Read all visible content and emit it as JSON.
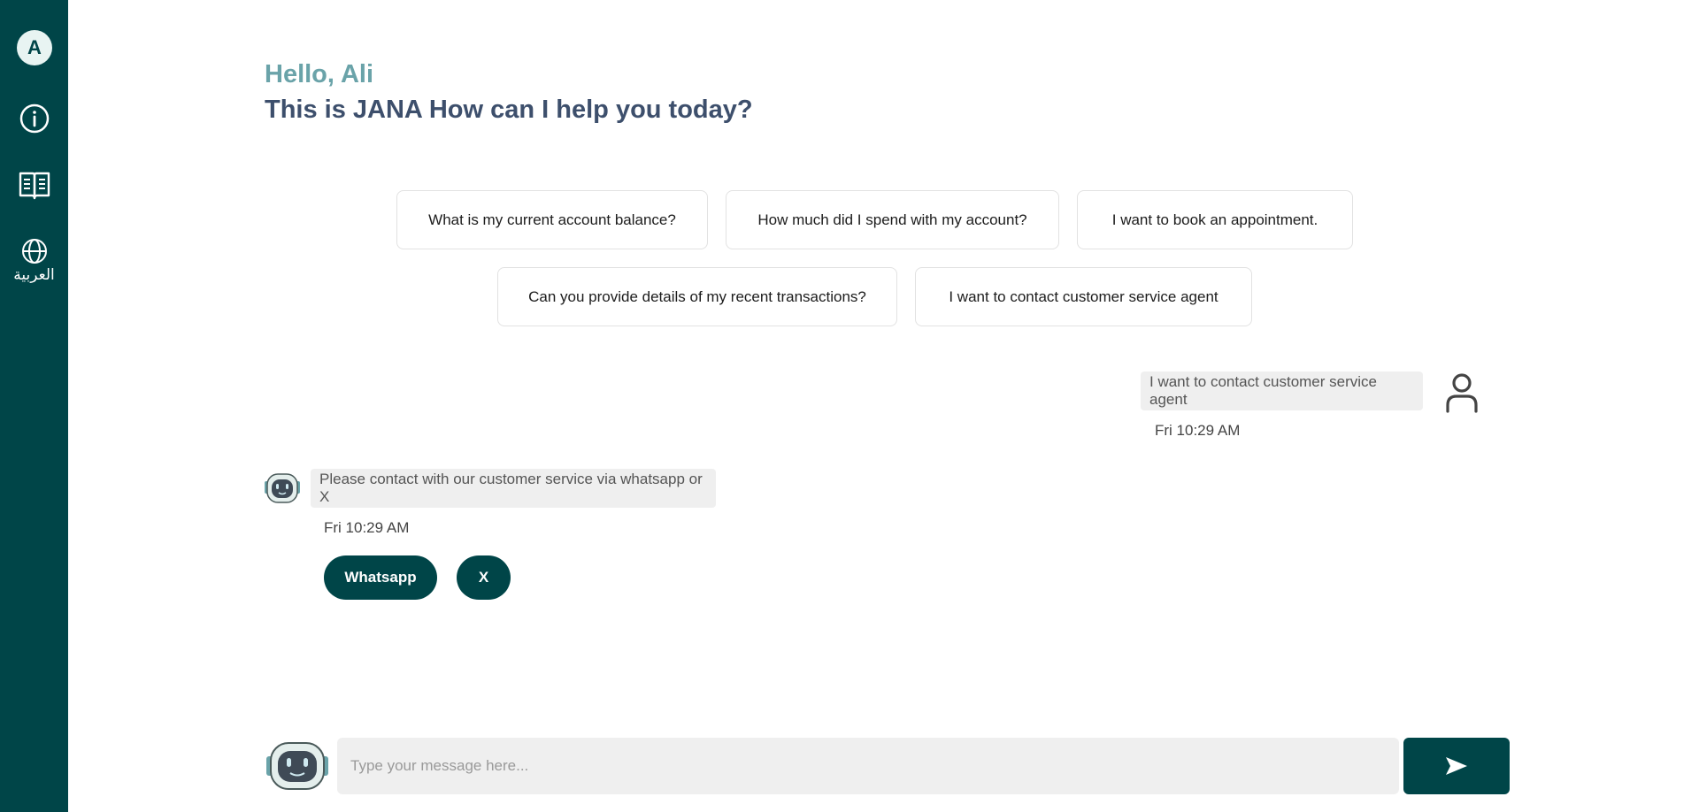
{
  "sidebar": {
    "avatar_letter": "A",
    "items": [
      {
        "icon": "info-icon"
      },
      {
        "icon": "book-icon"
      },
      {
        "icon": "globe-icon",
        "label": "العربية"
      }
    ]
  },
  "greeting": {
    "hello": "Hello, Ali",
    "prompt": "This is JANA How can I help you today?"
  },
  "suggestions": [
    "What is my current account balance?",
    "How much did I spend with my account?",
    "I want to book an appointment.",
    "Can you provide details of my recent transactions?",
    "I want to contact customer service agent"
  ],
  "messages": [
    {
      "sender": "user",
      "text": "I want to contact customer service agent",
      "time": "Fri 10:29 AM"
    },
    {
      "sender": "bot",
      "text": "Please contact with our customer service via whatsapp or X",
      "time": "Fri 10:29 AM"
    }
  ],
  "actions": [
    "Whatsapp",
    "X"
  ],
  "composer": {
    "placeholder": "Type your message here..."
  },
  "colors": {
    "primary": "#004548",
    "greeting_accent": "#6aa3a9",
    "heading": "#3d4f6c",
    "bubble_bg": "#efefef"
  }
}
